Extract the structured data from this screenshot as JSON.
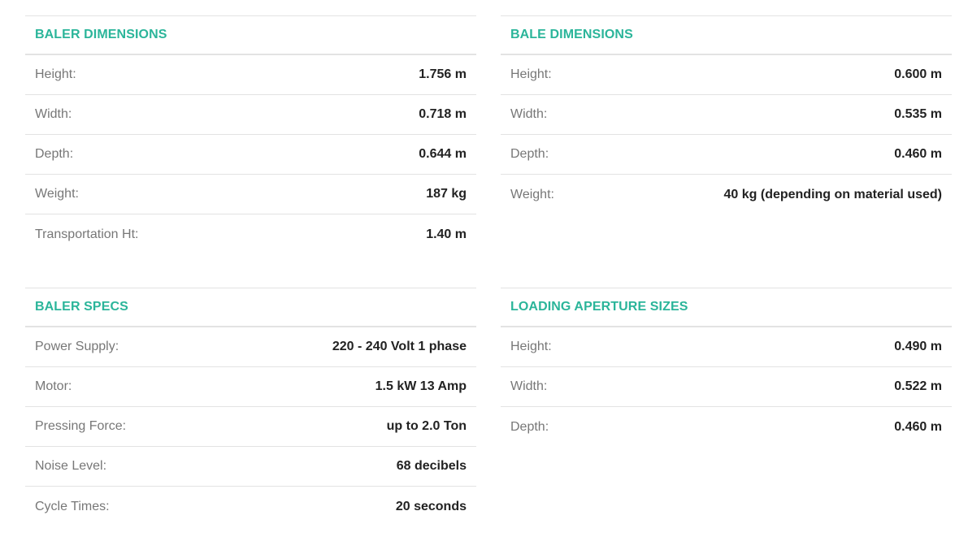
{
  "baler_dimensions": {
    "title": "BALER DIMENSIONS",
    "rows": [
      {
        "label": "Height:",
        "value": "1.756 m"
      },
      {
        "label": "Width:",
        "value": "0.718 m"
      },
      {
        "label": "Depth:",
        "value": "0.644 m"
      },
      {
        "label": "Weight:",
        "value": "187 kg"
      },
      {
        "label": "Transportation Ht:",
        "value": "1.40 m"
      }
    ]
  },
  "bale_dimensions": {
    "title": "BALE DIMENSIONS",
    "rows": [
      {
        "label": "Height:",
        "value": "0.600 m"
      },
      {
        "label": "Width:",
        "value": "0.535 m"
      },
      {
        "label": "Depth:",
        "value": "0.460 m"
      },
      {
        "label": "Weight:",
        "value": "40 kg (depending on material used)"
      }
    ]
  },
  "baler_specs": {
    "title": "BALER SPECS",
    "rows": [
      {
        "label": "Power Supply:",
        "value": "220 - 240 Volt 1 phase"
      },
      {
        "label": "Motor:",
        "value": "1.5 kW 13 Amp"
      },
      {
        "label": "Pressing Force:",
        "value": "up to 2.0 Ton"
      },
      {
        "label": "Noise Level:",
        "value": "68 decibels"
      },
      {
        "label": "Cycle Times:",
        "value": "20 seconds"
      }
    ]
  },
  "loading_aperture_sizes": {
    "title": "LOADING APERTURE SIZES",
    "rows": [
      {
        "label": "Height:",
        "value": "0.490 m"
      },
      {
        "label": "Width:",
        "value": "0.522 m"
      },
      {
        "label": "Depth:",
        "value": "0.460 m"
      }
    ]
  },
  "colors": {
    "heading": "#2bb59a",
    "label": "#777777",
    "value": "#222222",
    "divider": "#e3e3e3"
  }
}
